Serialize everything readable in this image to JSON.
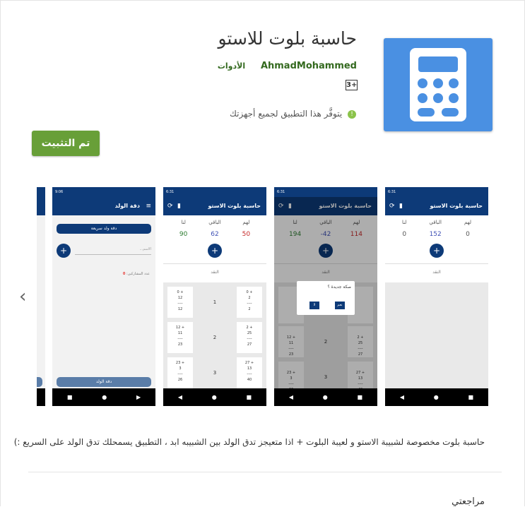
{
  "app": {
    "title": "حاسبة بلوت للاستو",
    "developer": "AhmadMohammed",
    "category": "الأدوات",
    "content_rating": "3+",
    "availability": "يتوفَّر هذا التطبيق لجميع أجهزتك",
    "install_label": "تم التثبيت",
    "description": "حاسبة بلوت مخصوصة لشبيبة الاستو و لعيبة البلوت + اذا متعيجز تدق الولد بين الشبيبه ابد ، التطبيق يسمحلك تدق الولد على السريع :)",
    "reviews_label": "مراجعتي",
    "accent_color": "#689f38",
    "icon_color": "#4a90e2"
  },
  "screenshots": {
    "calc_title": "حاسبة بلوت الاستو",
    "col_lahum": "لهم",
    "col_albaqi": "الباقي",
    "col_lana": "لنا",
    "total_label": "النقد",
    "shot1": {
      "lahum": "0",
      "albaqi": "152",
      "lana": "0"
    },
    "shot2": {
      "lahum": "114",
      "albaqi": "-42",
      "lana": "194",
      "dialog_title": "صكة جديدة ؟",
      "dialog_yes": "نعم",
      "dialog_no": "لا"
    },
    "shot3": {
      "lahum": "50",
      "albaqi": "62",
      "lana": "90",
      "rounds": [
        {
          "num": "1",
          "right_card": [
            "0 +",
            "2",
            "----",
            "2"
          ],
          "left_card": [
            "0 +",
            "12",
            "----",
            "12"
          ]
        },
        {
          "num": "2",
          "right_card": [
            "2 +",
            "25",
            "----",
            "27"
          ],
          "left_card": [
            "12 +",
            "11",
            "----",
            "23"
          ]
        },
        {
          "num": "3",
          "right_card": [
            "27 +",
            "13",
            "----",
            "40"
          ],
          "left_card": [
            "23 +",
            "3",
            "----",
            "26"
          ]
        }
      ]
    },
    "shot4": {
      "title": "دقة الولد",
      "quick_button": "دقة ولد سريعة",
      "name_placeholder": "الاسم...",
      "participants_label": "عدد المشاركين:",
      "participants_count": "0",
      "bottom_button": "دقة الولد",
      "status_time": "9:06"
    },
    "status_time": "6:31"
  }
}
